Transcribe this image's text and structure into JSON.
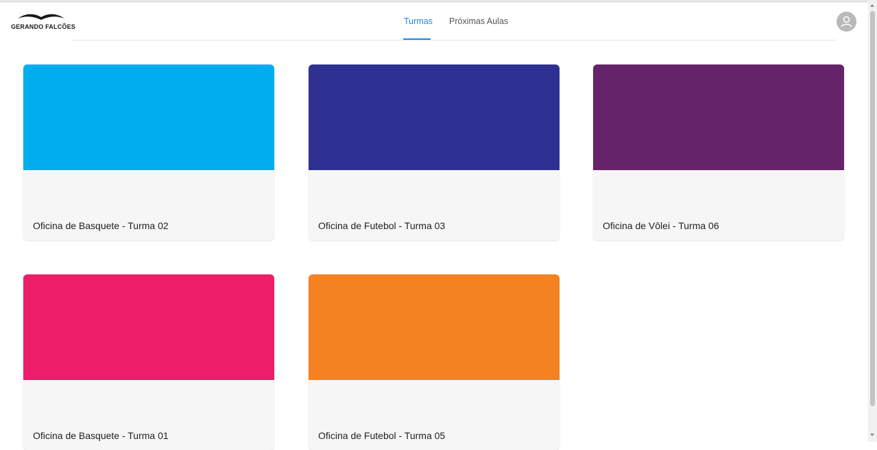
{
  "brand": {
    "name": "GERANDO FALCÕES"
  },
  "nav": {
    "tabs": [
      {
        "label": "Turmas",
        "active": true
      },
      {
        "label": "Próximas Aulas",
        "active": false
      }
    ]
  },
  "user": {
    "avatar_icon": "user-icon"
  },
  "cards": [
    {
      "title": "Oficina de Basquete - Turma 02",
      "color": "#00adee"
    },
    {
      "title": "Oficina de Futebol - Turma 03",
      "color": "#2e3192"
    },
    {
      "title": "Oficina de Vôlei - Turma 06",
      "color": "#652369"
    },
    {
      "title": "Oficina de Basquete - Turma 01",
      "color": "#ec1e69"
    },
    {
      "title": "Oficina de Futebol - Turma 05",
      "color": "#f48221"
    }
  ],
  "colors": {
    "accent": "#1e88e5",
    "card_background": "#f6f6f6"
  }
}
